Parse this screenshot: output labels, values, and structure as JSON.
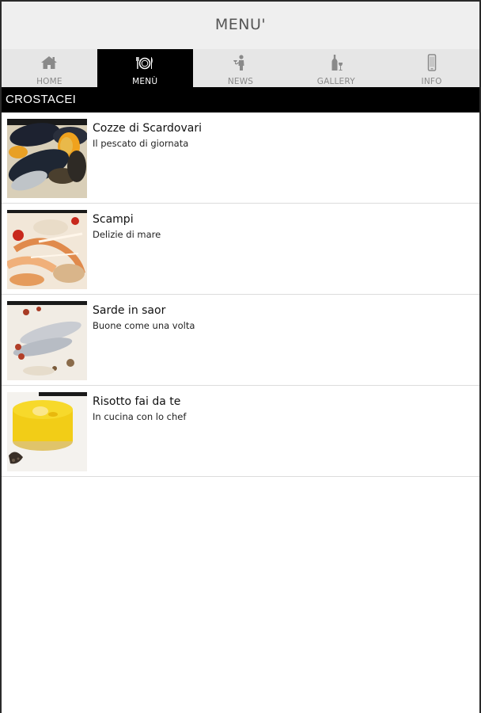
{
  "header": {
    "title": "MENU'"
  },
  "tabs": [
    {
      "label": "HOME",
      "icon": "home-icon"
    },
    {
      "label": "MENÙ",
      "icon": "plate-cutlery-icon",
      "active": true
    },
    {
      "label": "NEWS",
      "icon": "waiter-icon"
    },
    {
      "label": "GALLERY",
      "icon": "wine-bottle-icon"
    },
    {
      "label": "INFO",
      "icon": "phone-icon"
    }
  ],
  "section": {
    "title": "CROSTACEI"
  },
  "items": [
    {
      "title": "Cozze di Scardovari",
      "subtitle": "Il pescato di giornata",
      "image": "mussels-photo"
    },
    {
      "title": "Scampi",
      "subtitle": "Delizie di mare",
      "image": "scampi-photo"
    },
    {
      "title": "Sarde in saor",
      "subtitle": "Buone come una volta",
      "image": "sardines-photo"
    },
    {
      "title": "Risotto fai da te",
      "subtitle": "In cucina con lo chef",
      "image": "risotto-photo"
    }
  ],
  "colors": {
    "header_bg": "#efefef",
    "tabbar_bg": "#e6e6e6",
    "active_tab": "#000000",
    "section_bar": "#000000"
  }
}
